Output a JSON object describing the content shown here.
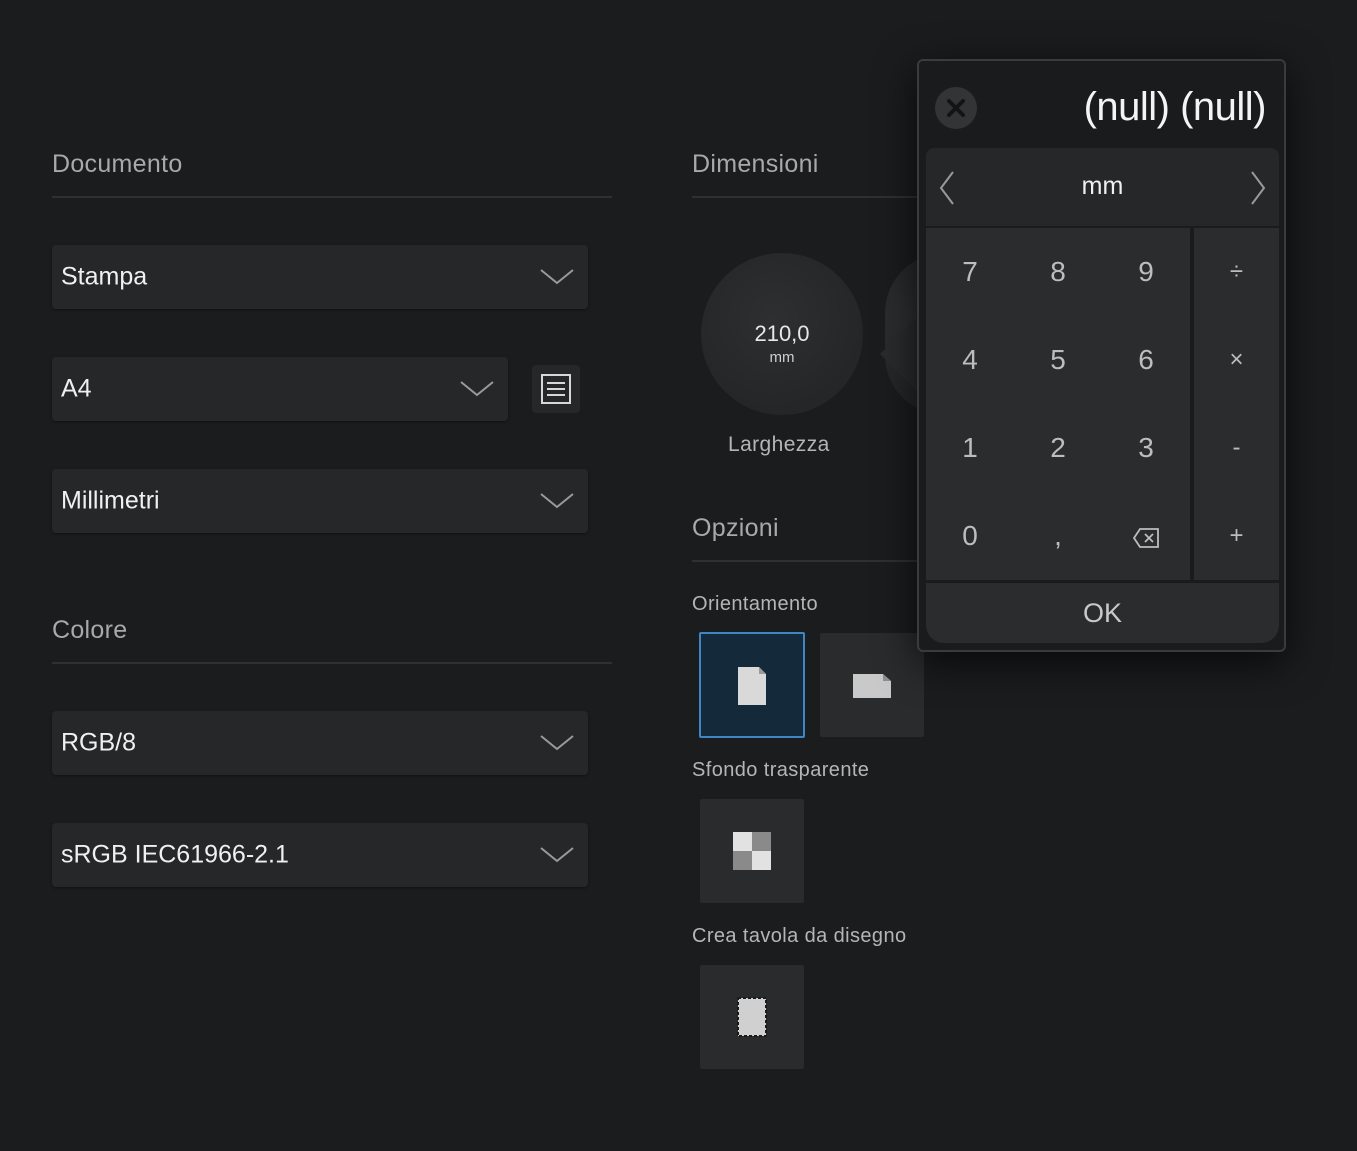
{
  "left": {
    "documento_title": "Documento",
    "stampa": "Stampa",
    "a4": "A4",
    "millimetri": "Millimetri",
    "colore_title": "Colore",
    "rgb8": "RGB/8",
    "srgb": "sRGB IEC61966-2.1"
  },
  "right": {
    "dimensioni_title": "Dimensioni",
    "width_value": "210,0",
    "width_unit": "mm",
    "width_label": "Larghezza",
    "opzioni_title": "Opzioni",
    "orientamento": "Orientamento",
    "sfondo": "Sfondo trasparente",
    "tavola": "Crea tavola da disegno"
  },
  "keypad": {
    "title": "(null) (null)",
    "unit": "mm",
    "keys": [
      "7",
      "8",
      "9",
      "4",
      "5",
      "6",
      "1",
      "2",
      "3",
      "0",
      ","
    ],
    "ops": [
      "÷",
      "×",
      "-",
      "+"
    ],
    "ok": "OK"
  },
  "icons": {
    "dropdown": "chevron-down-icon",
    "preset": "list-icon",
    "close": "close-icon",
    "backspace": "backspace-icon",
    "portrait": "portrait-page-icon",
    "landscape": "landscape-page-icon",
    "transparent": "checkerboard-icon",
    "artboard": "artboard-icon"
  }
}
